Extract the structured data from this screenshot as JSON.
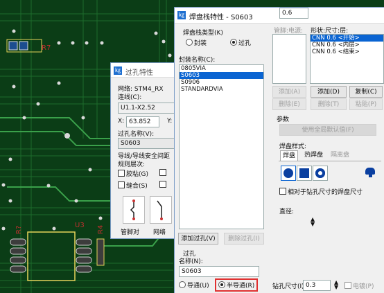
{
  "colors": {
    "accent": "#0a64d2",
    "pcb_bg": "#0b3d16",
    "highlight": "#e03030"
  },
  "pcb": {
    "ref_r7": "R7",
    "ref_u3": "U3",
    "ref_r_left": "R?",
    "ref_r4": "R4"
  },
  "via_panel": {
    "title": "过孔特性",
    "net_label": "网络: STM4_RX",
    "connect_label": "连线(C):",
    "connect_value": "U1.1-X2.52",
    "x_label": "X:",
    "x_value": "63.852",
    "y_label": "Y:",
    "via_name_label": "过孔名称(V):",
    "via_name_value": "S0603",
    "rule_text_1": "导线/导线安全间距",
    "rule_text_2": "规则层次:",
    "check_paste": "胶粘(G)",
    "check_2": "",
    "check_solder": "缝合(S)",
    "check_4": "",
    "btn_pinpair": "管脚对",
    "btn_net": "网络"
  },
  "padstack": {
    "title": "焊盘栈特性 - S0603",
    "type_label": "焊盘栈类型(K)",
    "radio_package": "封装",
    "radio_via": "过孔",
    "pkg_name_label": "封装名称(C):",
    "items": [
      "0805VIA",
      "S0603",
      "S0906",
      "STANDARDVIA"
    ],
    "selected": "S0603",
    "pin_electrical": "管脚:电源:",
    "shape_label": "形状:尺寸:层:",
    "layers": [
      "CNN 0.6 <开始>",
      "CNN 0.6 <内层>",
      "CNN 0.6 <结束>"
    ],
    "btn_add_a": "添加(A)",
    "btn_add_d": "添加(D)",
    "btn_copy": "复制(C)",
    "btn_del_e": "删除(E)",
    "btn_del_t": "删除(T)",
    "btn_paste": "粘贴(P)",
    "params_label": "参数",
    "btn_global": "使用全局默认值(F)",
    "pad_style_label": "焊盘样式:",
    "tab_pad": "焊盘",
    "tab_thermal": "热焊盘",
    "tab_anti": "隔离盘",
    "check_relative": "相对于钻孔尺寸的焊盘尺寸",
    "diameter_label": "直径:",
    "diameter_value": "0.6",
    "btn_add_via": "添加过孔(V)",
    "btn_del_via": "删除过孔(I)",
    "via_label": "过孔",
    "name_label": "名称(N):",
    "name_value": "S0603",
    "radio_through": "导通(U)",
    "radio_half": "半导通(R)",
    "drill_label": "钻孔尺寸(I)",
    "drill_value": "0.3",
    "plated_label": "电镀(P)"
  }
}
